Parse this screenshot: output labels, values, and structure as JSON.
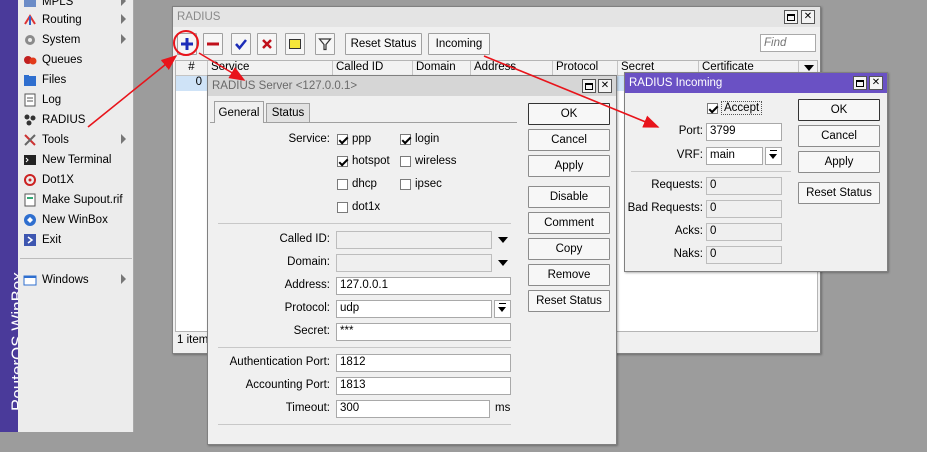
{
  "brand": {
    "vertical_text": "RouterOS WinBox"
  },
  "sidebar": {
    "items": [
      {
        "label": "MPLS",
        "icon": "mpls-icon",
        "submenu": true
      },
      {
        "label": "Routing",
        "icon": "routing-icon",
        "submenu": true
      },
      {
        "label": "System",
        "icon": "gear-icon",
        "submenu": true
      },
      {
        "label": "Queues",
        "icon": "queues-icon",
        "submenu": false
      },
      {
        "label": "Files",
        "icon": "folder-icon",
        "submenu": false
      },
      {
        "label": "Log",
        "icon": "log-icon",
        "submenu": false
      },
      {
        "label": "RADIUS",
        "icon": "radius-icon",
        "submenu": false
      },
      {
        "label": "Tools",
        "icon": "tools-icon",
        "submenu": true
      },
      {
        "label": "New Terminal",
        "icon": "terminal-icon",
        "submenu": false
      },
      {
        "label": "Dot1X",
        "icon": "dot1x-icon",
        "submenu": false
      },
      {
        "label": "Make Supout.rif",
        "icon": "supout-icon",
        "submenu": false
      },
      {
        "label": "New WinBox",
        "icon": "winbox-icon",
        "submenu": false
      },
      {
        "label": "Exit",
        "icon": "exit-icon",
        "submenu": false
      },
      {
        "label": "Windows",
        "icon": "windows-icon",
        "submenu": true
      }
    ]
  },
  "radius_window": {
    "title": "RADIUS",
    "toolbar": {
      "reset_status": "Reset Status",
      "incoming": "Incoming",
      "find_placeholder": "Find"
    },
    "columns": [
      "#",
      "Service",
      "Called ID",
      "Domain",
      "Address",
      "Protocol",
      "Secret",
      "Certificate"
    ],
    "rows": [
      {
        "num": "0"
      }
    ],
    "status": "1 item"
  },
  "server_window": {
    "title": "RADIUS Server <127.0.0.1>",
    "tabs": [
      "General",
      "Status"
    ],
    "service_label": "Service:",
    "services": [
      {
        "label": "ppp",
        "checked": true
      },
      {
        "label": "login",
        "checked": true
      },
      {
        "label": "hotspot",
        "checked": true
      },
      {
        "label": "wireless",
        "checked": false
      },
      {
        "label": "dhcp",
        "checked": false
      },
      {
        "label": "ipsec",
        "checked": false
      },
      {
        "label": "dot1x",
        "checked": false
      }
    ],
    "fields": {
      "called_id_label": "Called ID:",
      "domain_label": "Domain:",
      "address_label": "Address:",
      "address_value": "127.0.0.1",
      "protocol_label": "Protocol:",
      "protocol_value": "udp",
      "secret_label": "Secret:",
      "secret_value": "***",
      "auth_port_label": "Authentication Port:",
      "auth_port_value": "1812",
      "acct_port_label": "Accounting Port:",
      "acct_port_value": "1813",
      "timeout_label": "Timeout:",
      "timeout_value": "300",
      "timeout_unit": "ms"
    },
    "buttons": [
      "OK",
      "Cancel",
      "Apply",
      "Disable",
      "Comment",
      "Copy",
      "Remove",
      "Reset Status"
    ]
  },
  "incoming_window": {
    "title": "RADIUS Incoming",
    "accept_label": "Accept",
    "accept_checked": true,
    "port_label": "Port:",
    "port_value": "3799",
    "vrf_label": "VRF:",
    "vrf_value": "main",
    "requests_label": "Requests:",
    "requests_value": "0",
    "bad_requests_label": "Bad Requests:",
    "bad_requests_value": "0",
    "acks_label": "Acks:",
    "acks_value": "0",
    "naks_label": "Naks:",
    "naks_value": "0",
    "buttons": [
      "OK",
      "Cancel",
      "Apply",
      "Reset Status"
    ]
  },
  "colors": {
    "active_title": "#6a51c4",
    "brand_bar": "#4a3a9a",
    "annotation": "#e8141b",
    "add_icon": "#1d2db8",
    "remove_icon": "#c0101a"
  }
}
